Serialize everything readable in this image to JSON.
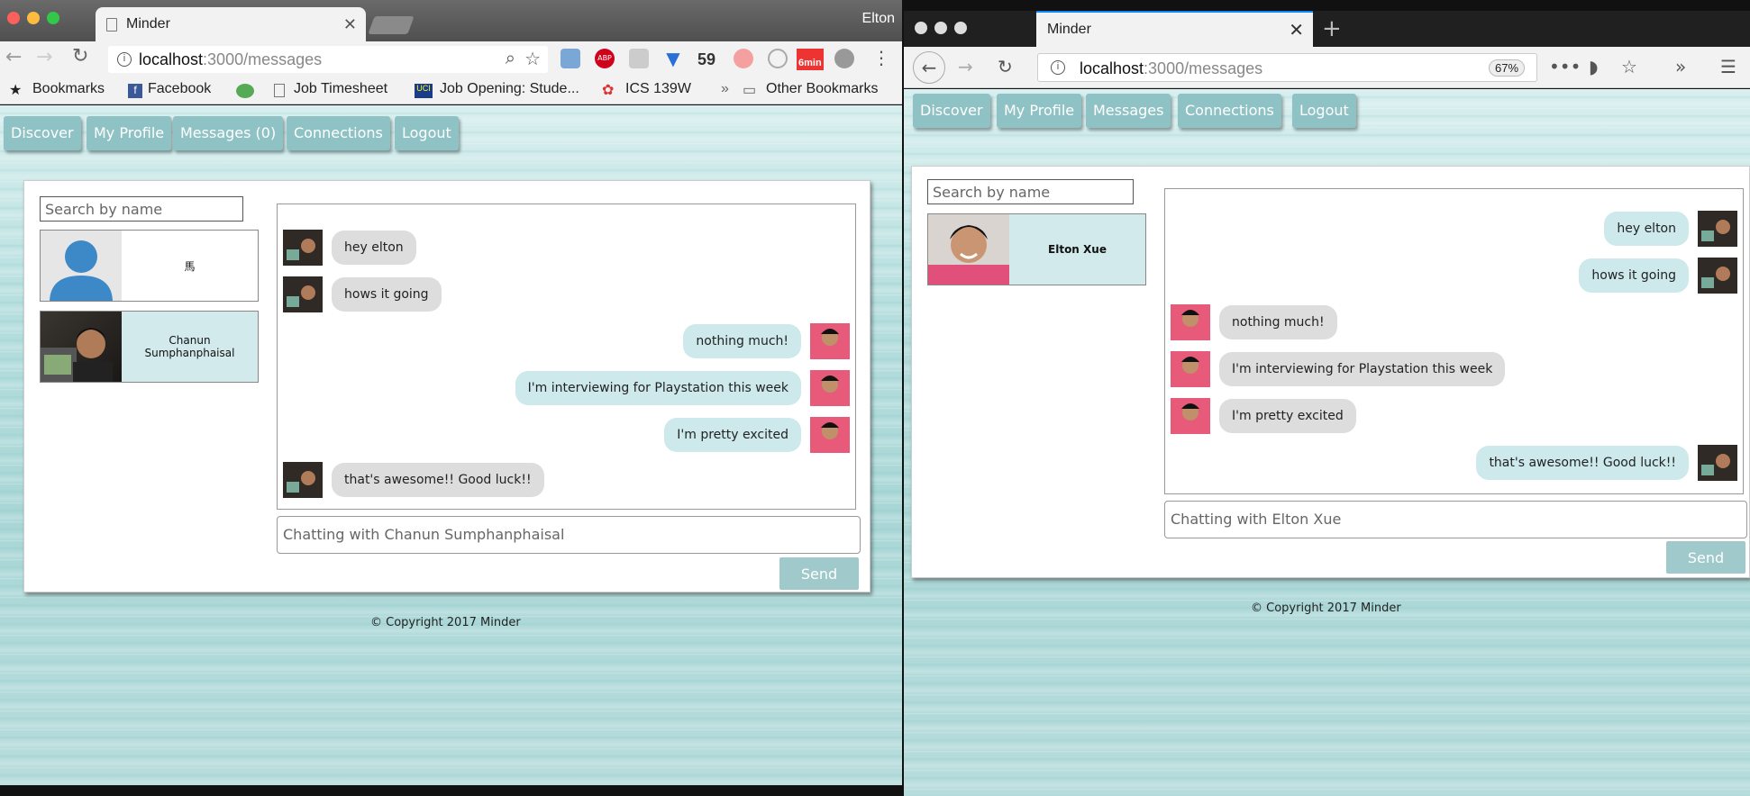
{
  "chrome": {
    "tab_title": "Minder",
    "user": "Elton",
    "url_host": "localhost",
    "url_path": ":3000/messages",
    "ext_count": "59",
    "ext_timer": "6min",
    "bookmarks": [
      "Bookmarks",
      "Facebook",
      "Job Timesheet",
      "Job Opening: Stude...",
      "ICS 139W",
      "»",
      "Other Bookmarks"
    ]
  },
  "firefox": {
    "tab_title": "Minder",
    "url_host": "localhost",
    "url_path": ":3000/messages",
    "zoom": "67%"
  },
  "left_app": {
    "nav": [
      "Discover",
      "My Profile",
      "Messages (0)",
      "Connections",
      "Logout"
    ],
    "search_placeholder": "Search by name",
    "contacts": [
      {
        "name": "馬",
        "selected": false
      },
      {
        "name": "Chanun Sumphanphaisal",
        "selected": true
      }
    ],
    "messages": [
      {
        "text": "hey elton",
        "side": "in"
      },
      {
        "text": "hows it going",
        "side": "in"
      },
      {
        "text": "nothing much!",
        "side": "out"
      },
      {
        "text": "I'm interviewing for Playstation this week",
        "side": "out"
      },
      {
        "text": "I'm pretty excited",
        "side": "out"
      },
      {
        "text": "that's awesome!! Good luck!!",
        "side": "in"
      }
    ],
    "input_placeholder": "Chatting with Chanun Sumphanphaisal",
    "send": "Send",
    "copyright": "© Copyright 2017 Minder"
  },
  "right_app": {
    "nav": [
      "Discover",
      "My Profile",
      "Messages",
      "Connections",
      "Logout"
    ],
    "search_placeholder": "Search by name",
    "contacts": [
      {
        "name": "Elton Xue",
        "selected": true
      }
    ],
    "messages": [
      {
        "text": "hey elton",
        "side": "out"
      },
      {
        "text": "hows it going",
        "side": "out"
      },
      {
        "text": "nothing much!",
        "side": "in"
      },
      {
        "text": "I'm interviewing for Playstation this week",
        "side": "in"
      },
      {
        "text": "I'm pretty excited",
        "side": "in"
      },
      {
        "text": "that's awesome!! Good luck!!",
        "side": "out"
      }
    ],
    "input_placeholder": "Chatting with Elton Xue",
    "send": "Send",
    "copyright": "© Copyright 2017 Minder"
  }
}
